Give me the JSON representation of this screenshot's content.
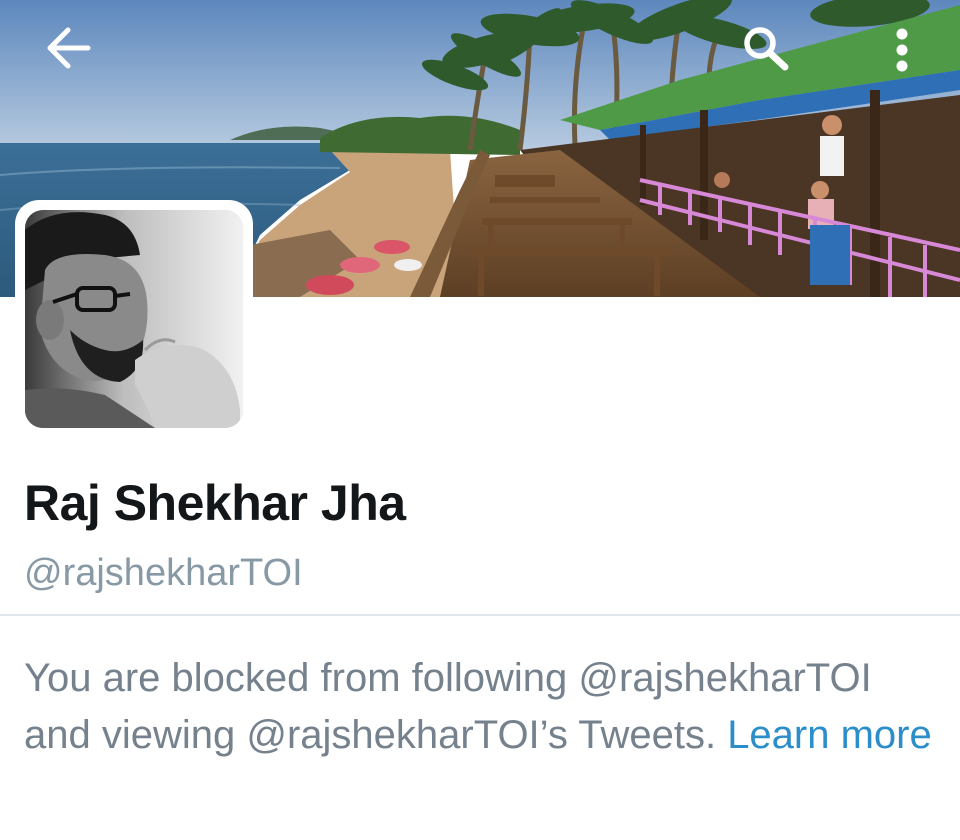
{
  "header": {
    "back_icon": "arrow-left-icon",
    "search_icon": "search-icon",
    "more_icon": "vertical-dots-icon"
  },
  "profile": {
    "display_name": "Raj Shekhar Jha",
    "handle": "@rajshekharTOI"
  },
  "blocked_notice": {
    "message": "You are blocked from following @rajshekharTOI and viewing @rajshekharTOI’s Tweets.",
    "link_text": "Learn more"
  },
  "colors": {
    "name_text": "#14171a",
    "secondary_text": "#8899a6",
    "message_text": "#75818c",
    "link": "#2b8ecb",
    "divider": "#e1e8ed"
  }
}
